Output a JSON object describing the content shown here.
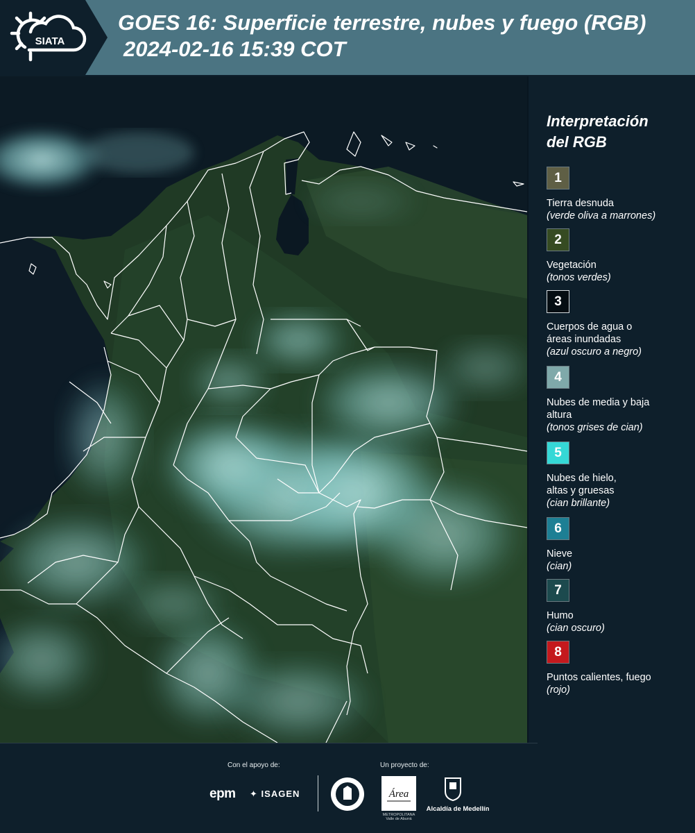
{
  "header": {
    "logo_text": "SIATA",
    "title_line1": "GOES 16: Superficie terrestre, nubes y fuego (RGB)",
    "title_line2": "2024-02-16 15:39 COT"
  },
  "legend": {
    "title_line1": "Interpretación",
    "title_line2": "del RGB",
    "items": [
      {
        "number": "1",
        "color": "#5f5f45",
        "label": "Tierra desnuda",
        "desc": "(verde oliva a marrones)"
      },
      {
        "number": "2",
        "color": "#364b22",
        "label": "Vegetación",
        "desc": "(tonos verdes)"
      },
      {
        "number": "3",
        "color": "#050d12",
        "label": "Cuerpos de agua o áreas inundadas",
        "desc": "(azul oscuro a negro)"
      },
      {
        "number": "4",
        "color": "#7fa9aa",
        "label": "Nubes de media y baja altura",
        "desc": "(tonos grises de cian)"
      },
      {
        "number": "5",
        "color": "#35d8d6",
        "label": "Nubes de hielo, altas y gruesas",
        "desc": "(cian brillante)"
      },
      {
        "number": "6",
        "color": "#1d7f94",
        "label": "Nieve",
        "desc": "(cian)"
      },
      {
        "number": "7",
        "color": "#1c4a4e",
        "label": "Humo",
        "desc": "(cian oscuro)"
      },
      {
        "number": "8",
        "color": "#c4191d",
        "label": "Puntos calientes, fuego",
        "desc": "(rojo)"
      }
    ]
  },
  "footer": {
    "support_label": "Con el apoyo de:",
    "project_label": "Un proyecto de:",
    "sponsor1": "epm",
    "sponsor2": "ISAGEN",
    "partner_amva": "Área",
    "partner_amva_sub": "METROPOLITANA Valle de Aburrá",
    "partner_alcaldia": "Alcaldía de Medellín"
  }
}
